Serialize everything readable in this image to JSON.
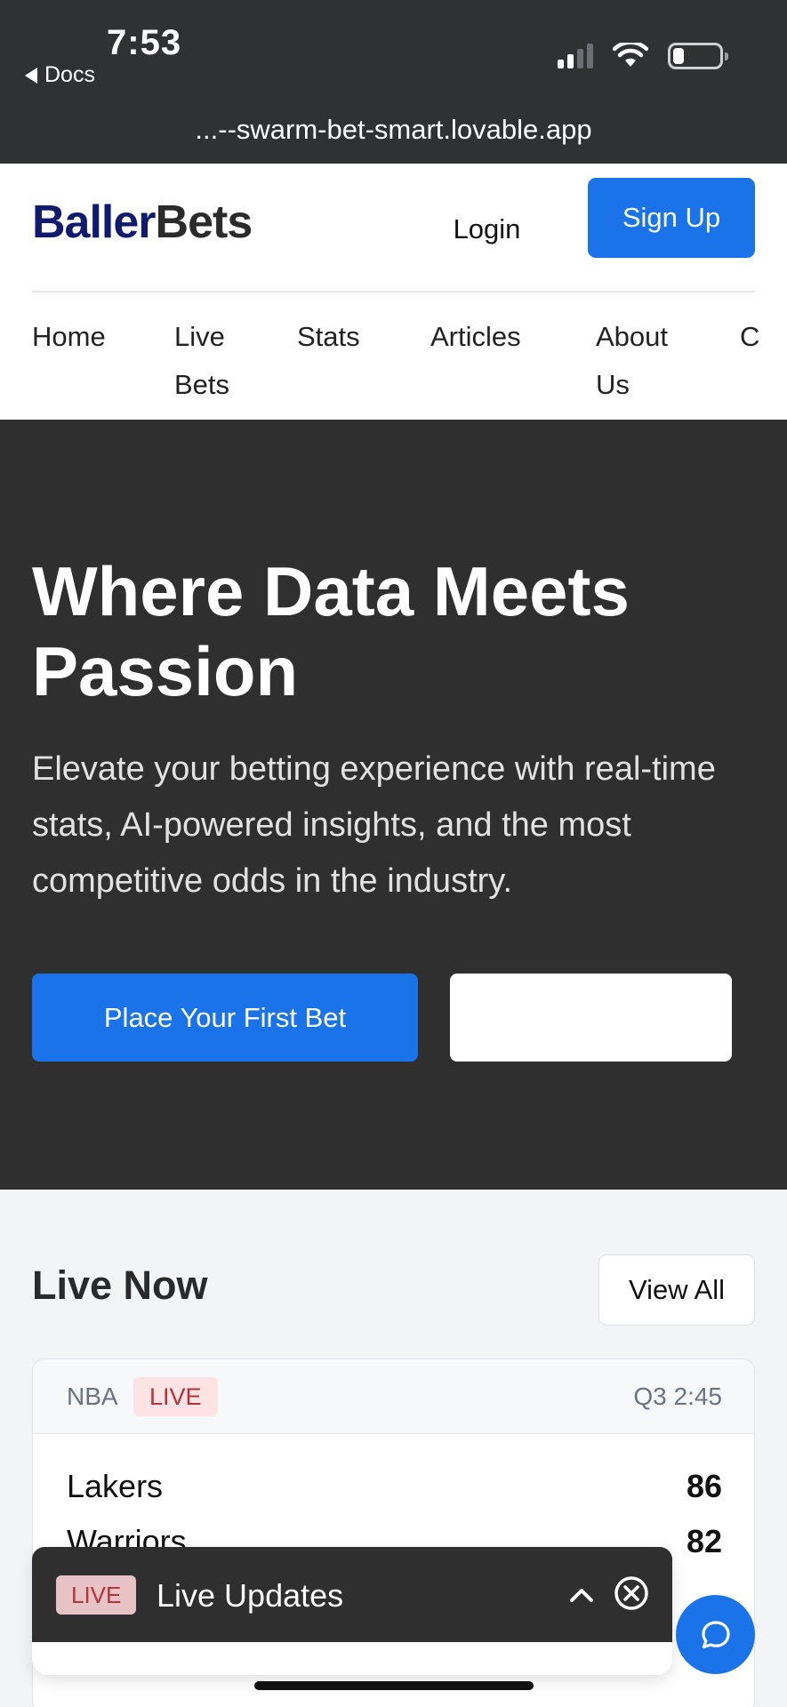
{
  "status_bar": {
    "time": "7:53",
    "back_label": "Docs",
    "url": "...--swarm-bet-smart.lovable.app"
  },
  "header": {
    "logo_primary": "Baller",
    "logo_secondary": "Bets",
    "login_label": "Login",
    "signup_label": "Sign Up",
    "nav": [
      {
        "label": "Home"
      },
      {
        "label": "Live\nBets"
      },
      {
        "label": "Stats"
      },
      {
        "label": "Articles"
      },
      {
        "label": "About\nUs"
      },
      {
        "label": "C"
      }
    ]
  },
  "hero": {
    "title": "Where Data Meets Passion",
    "subtitle": "Elevate your betting experience with real-time stats, AI-powered insights, and the most competitive odds in the industry.",
    "primary_cta": "Place Your First Bet",
    "secondary_cta": ""
  },
  "live_now": {
    "title": "Live Now",
    "view_all": "View All",
    "game": {
      "league": "NBA",
      "badge": "LIVE",
      "clock": "Q3 2:45",
      "teams": [
        {
          "name": "Lakers",
          "score": "86"
        },
        {
          "name": "Warriors",
          "score": "82"
        }
      ]
    }
  },
  "live_updates": {
    "badge": "LIVE",
    "title": "Live Updates"
  },
  "colors": {
    "accent": "#1a73e8",
    "logo_dark": "#101a6e",
    "hero_bg": "#2f2f30",
    "live_red": "#b4333a"
  },
  "icons": [
    "back-arrow-icon",
    "signal-icon",
    "wifi-icon",
    "battery-icon",
    "chevron-up-icon",
    "close-circle-icon",
    "chat-icon"
  ]
}
